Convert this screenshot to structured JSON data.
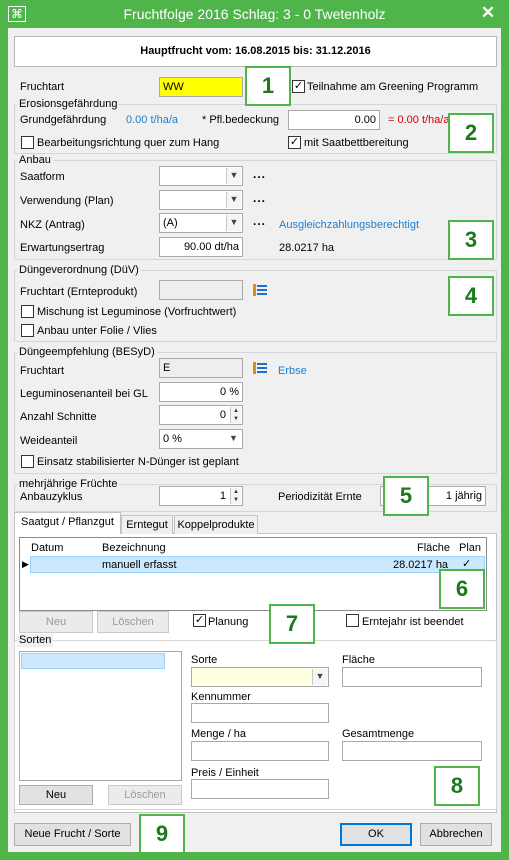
{
  "window": {
    "title": "Fruchtfolge 2016 Schlag: 3 - 0 Twetenholz",
    "close": "✕",
    "app_icon": "⌘"
  },
  "header": "Hauptfrucht vom: 16.08.2015 bis: 31.12.2016",
  "fruchtart": {
    "label": "Fruchtart",
    "value": "WW",
    "greening_label": "Teilnahme am Greening Programm",
    "greening_checked": "✓"
  },
  "erosion": {
    "title": "Erosionsgefährdung",
    "grund_label": "Grundgefährdung",
    "grund_value": "0.00 t/ha/a",
    "pfl_label": "* Pfl.bedeckung",
    "pfl_value": "0.00",
    "result": "= 0.00 t/ha/a",
    "quer_label": "Bearbeitungsrichtung quer zum Hang",
    "saatbett_label": "mit Saatbettbereitung",
    "saatbett_checked": "✓"
  },
  "anbau": {
    "title": "Anbau",
    "saatform_label": "Saatform",
    "verwendung_label": "Verwendung (Plan)",
    "nkz_label": "NKZ  (Antrag)",
    "nkz_value": "(A)",
    "ausgleich": "Ausgleichzahlungsberechtigt",
    "ertrag_label": "Erwartungsertrag",
    "ertrag_value": "90.00 dt/ha",
    "ertrag_area": "28.0217 ha",
    "dots": "..."
  },
  "duev": {
    "title": "Düngeverordnung (DüV)",
    "fruchtart_label": "Fruchtart (Ernteprodukt)",
    "fruchtart_value": "",
    "mischung_label": "Mischung ist Leguminose (Vorfruchtwert)",
    "folie_label": "Anbau unter Folie / Vlies"
  },
  "besyd": {
    "title": "Düngeempfehlung (BESyD)",
    "fruchtart_label": "Fruchtart",
    "fruchtart_value": "E",
    "fruchtart_link": "Erbse",
    "legum_label": "Leguminosenanteil bei GL",
    "legum_value": "0 %",
    "schnitte_label": "Anzahl Schnitte",
    "schnitte_value": "0",
    "weide_label": "Weideanteil",
    "weide_value": "0 %",
    "nduenger_label": "Einsatz stabilisierter N-Dünger ist geplant"
  },
  "mehrjahr": {
    "title": "mehrjährige Früchte",
    "zyklus_label": "Anbauzyklus",
    "zyklus_value": "1",
    "period_label": "Periodizität Ernte",
    "period_value": "1 jährig"
  },
  "tabs": [
    "Saatgut / Pflanzgut",
    "Erntegut",
    "Koppelprodukte"
  ],
  "grid": {
    "headers": [
      "Datum",
      "Bezeichnung",
      "Fläche",
      "Plan"
    ],
    "rows": [
      {
        "datum": "",
        "bezeichnung": "manuell erfasst",
        "flaeche": "28.0217 ha",
        "plan": "✓"
      }
    ],
    "row_marker": "▶"
  },
  "actions": {
    "neu": "Neu",
    "loeschen": "Löschen",
    "planung_label": "Planung",
    "planung_checked": "✓",
    "erntejahr_label": "Erntejahr ist beendet"
  },
  "sorten": {
    "title": "Sorten",
    "sorte_label": "Sorte",
    "flaeche_label": "Fläche",
    "kennnummer_label": "Kennummer",
    "menge_label": "Menge / ha",
    "gesamt_label": "Gesamtmenge",
    "preis_label": "Preis / Einheit",
    "neu": "Neu",
    "loeschen": "Löschen"
  },
  "footer": {
    "neue_frucht": "Neue Frucht / Sorte",
    "ok": "OK",
    "abbrechen": "Abbrechen"
  },
  "badges": [
    "1",
    "2",
    "3",
    "4",
    "5",
    "6",
    "7",
    "8",
    "9"
  ],
  "icons": {
    "dropdown": "▼",
    "spin_up": "▲",
    "spin_down": "▼",
    "list_icon": "list-picker"
  },
  "colors": {
    "frame": "#4fb54a",
    "link": "#1e7fd1",
    "warning": "#d40000",
    "highlight": "#ffff00",
    "selection": "#cce8ff"
  }
}
